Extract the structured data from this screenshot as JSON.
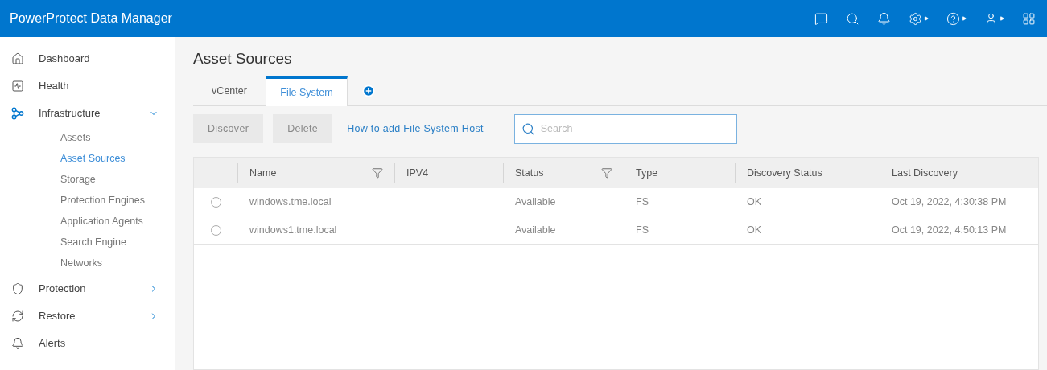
{
  "header": {
    "title": "PowerProtect Data Manager"
  },
  "sidebar": {
    "items": [
      {
        "label": "Dashboard",
        "kind": "home"
      },
      {
        "label": "Health",
        "kind": "health"
      },
      {
        "label": "Infrastructure",
        "kind": "infra",
        "expanded": true,
        "children": [
          {
            "label": "Assets",
            "selected": false
          },
          {
            "label": "Asset Sources",
            "selected": true
          },
          {
            "label": "Storage",
            "selected": false
          },
          {
            "label": "Protection Engines",
            "selected": false
          },
          {
            "label": "Application Agents",
            "selected": false
          },
          {
            "label": "Search Engine",
            "selected": false
          },
          {
            "label": "Networks",
            "selected": false
          }
        ]
      },
      {
        "label": "Protection",
        "kind": "shield",
        "expanded": false
      },
      {
        "label": "Restore",
        "kind": "restore",
        "expanded": false
      },
      {
        "label": "Alerts",
        "kind": "bell"
      }
    ]
  },
  "page": {
    "title": "Asset Sources",
    "tabs": [
      {
        "label": "vCenter",
        "selected": false
      },
      {
        "label": "File System",
        "selected": true
      }
    ],
    "buttons": [
      {
        "label": "Discover",
        "disabled": true
      },
      {
        "label": "Delete",
        "disabled": true
      }
    ],
    "help_link": "How to add File System Host",
    "search": {
      "placeholder": "Search"
    },
    "table": {
      "columns": [
        {
          "label": "Name",
          "filter": true
        },
        {
          "label": "IPV4",
          "filter": false
        },
        {
          "label": "Status",
          "filter": true
        },
        {
          "label": "Type",
          "filter": false
        },
        {
          "label": "Discovery Status",
          "filter": false
        },
        {
          "label": "Last Discovery",
          "filter": false
        }
      ],
      "rows": [
        {
          "selected": false,
          "cells": [
            "windows.tme.local",
            "",
            "Available",
            "FS",
            "OK",
            "Oct 19, 2022, 4:30:38 PM"
          ]
        },
        {
          "selected": false,
          "cells": [
            "windows1.tme.local",
            "",
            "Available",
            "FS",
            "OK",
            "Oct 19, 2022, 4:50:13 PM"
          ]
        }
      ]
    }
  }
}
